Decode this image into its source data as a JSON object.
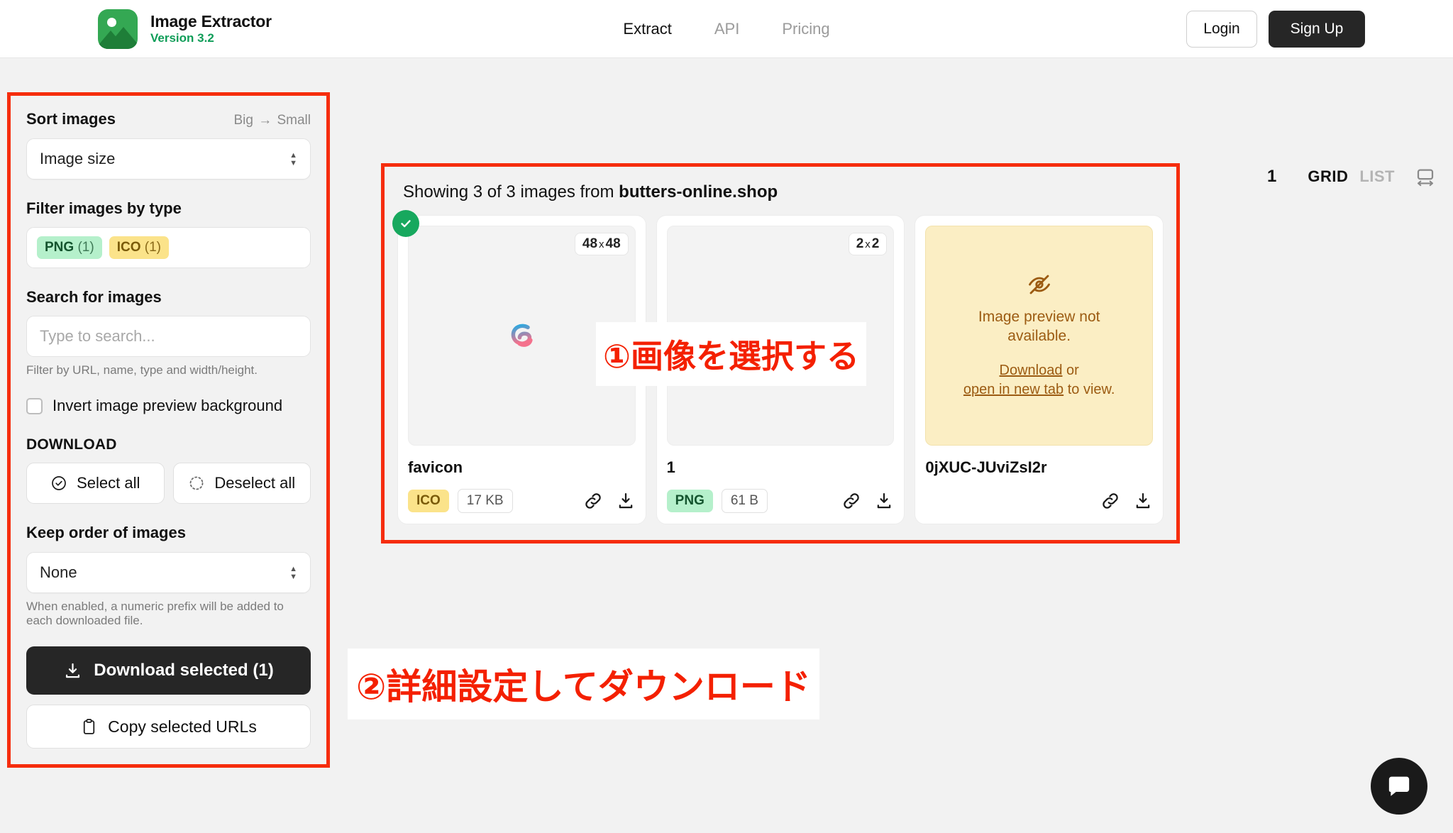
{
  "header": {
    "brand_title": "Image Extractor",
    "brand_version": "Version 3.2",
    "nav": [
      {
        "label": "Extract",
        "active": true
      },
      {
        "label": "API",
        "active": false
      },
      {
        "label": "Pricing",
        "active": false
      }
    ],
    "login_label": "Login",
    "signup_label": "Sign Up"
  },
  "sidebar": {
    "sort": {
      "label": "Sort images",
      "hint_left": "Big",
      "hint_arrow": "→",
      "hint_right": "Small",
      "selected": "Image size"
    },
    "filter": {
      "label": "Filter images by type",
      "chips": [
        {
          "type": "PNG",
          "count": "(1)"
        },
        {
          "type": "ICO",
          "count": "(1)"
        }
      ]
    },
    "search": {
      "label": "Search for images",
      "value": "",
      "placeholder": "Type to search...",
      "hint": "Filter by URL, name, type and width/height."
    },
    "invert_label": "Invert image preview background",
    "download_title": "DOWNLOAD",
    "select_all_label": "Select all",
    "deselect_all_label": "Deselect all",
    "keep_order": {
      "label": "Keep order of images",
      "selected": "None",
      "hint": "When enabled, a numeric prefix will be added to each downloaded file."
    },
    "download_selected_label": "Download selected (1)",
    "copy_urls_label": "Copy selected URLs"
  },
  "results": {
    "heading_prefix": "Showing 3 of 3 images from ",
    "heading_domain": "butters-online.shop",
    "cards": [
      {
        "name": "favicon",
        "dimensions": "48",
        "dimensions_y": "48",
        "format": "ICO",
        "size": "17 KB",
        "selected": true,
        "preview": "thumbnail"
      },
      {
        "name": "1",
        "dimensions": "2",
        "dimensions_y": "2",
        "format": "PNG",
        "size": "61 B",
        "selected": false,
        "preview": "blank"
      },
      {
        "name": "0jXUC-JUviZsI2r",
        "dimensions": "",
        "dimensions_y": "",
        "format": "",
        "size": "",
        "selected": false,
        "preview": "unavailable",
        "warn_line1": "Image preview not",
        "warn_line2": "available.",
        "warn_link1": "Download",
        "warn_mid": " or",
        "warn_link2": "open in new tab",
        "warn_tail": " to view."
      }
    ]
  },
  "view_controls": {
    "page_number": "1",
    "grid_label": "GRID",
    "list_label": "LIST"
  },
  "annotations": {
    "step1": "①画像を選択する",
    "step2": "②詳細設定してダウンロード"
  },
  "colors": {
    "brand_green": "#34a853",
    "version_green": "#0f9d58",
    "annotation_red": "#f42000",
    "dark_button": "#262626",
    "selected_green": "#17a85e"
  }
}
